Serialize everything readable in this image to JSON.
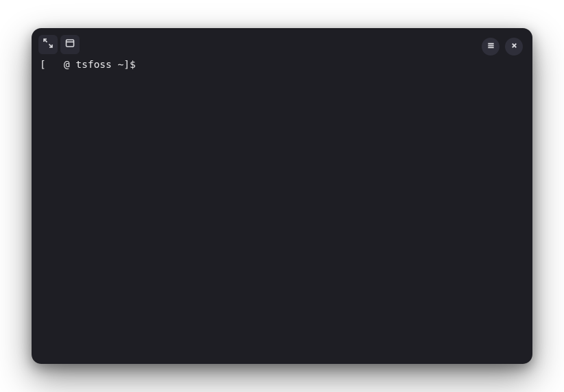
{
  "terminal": {
    "prompt": "[   @ tsfoss ~]$ ",
    "icons": {
      "fullscreen": "fullscreen-icon",
      "panel": "panel-icon",
      "menu": "hamburger-icon",
      "close": "close-icon"
    }
  }
}
